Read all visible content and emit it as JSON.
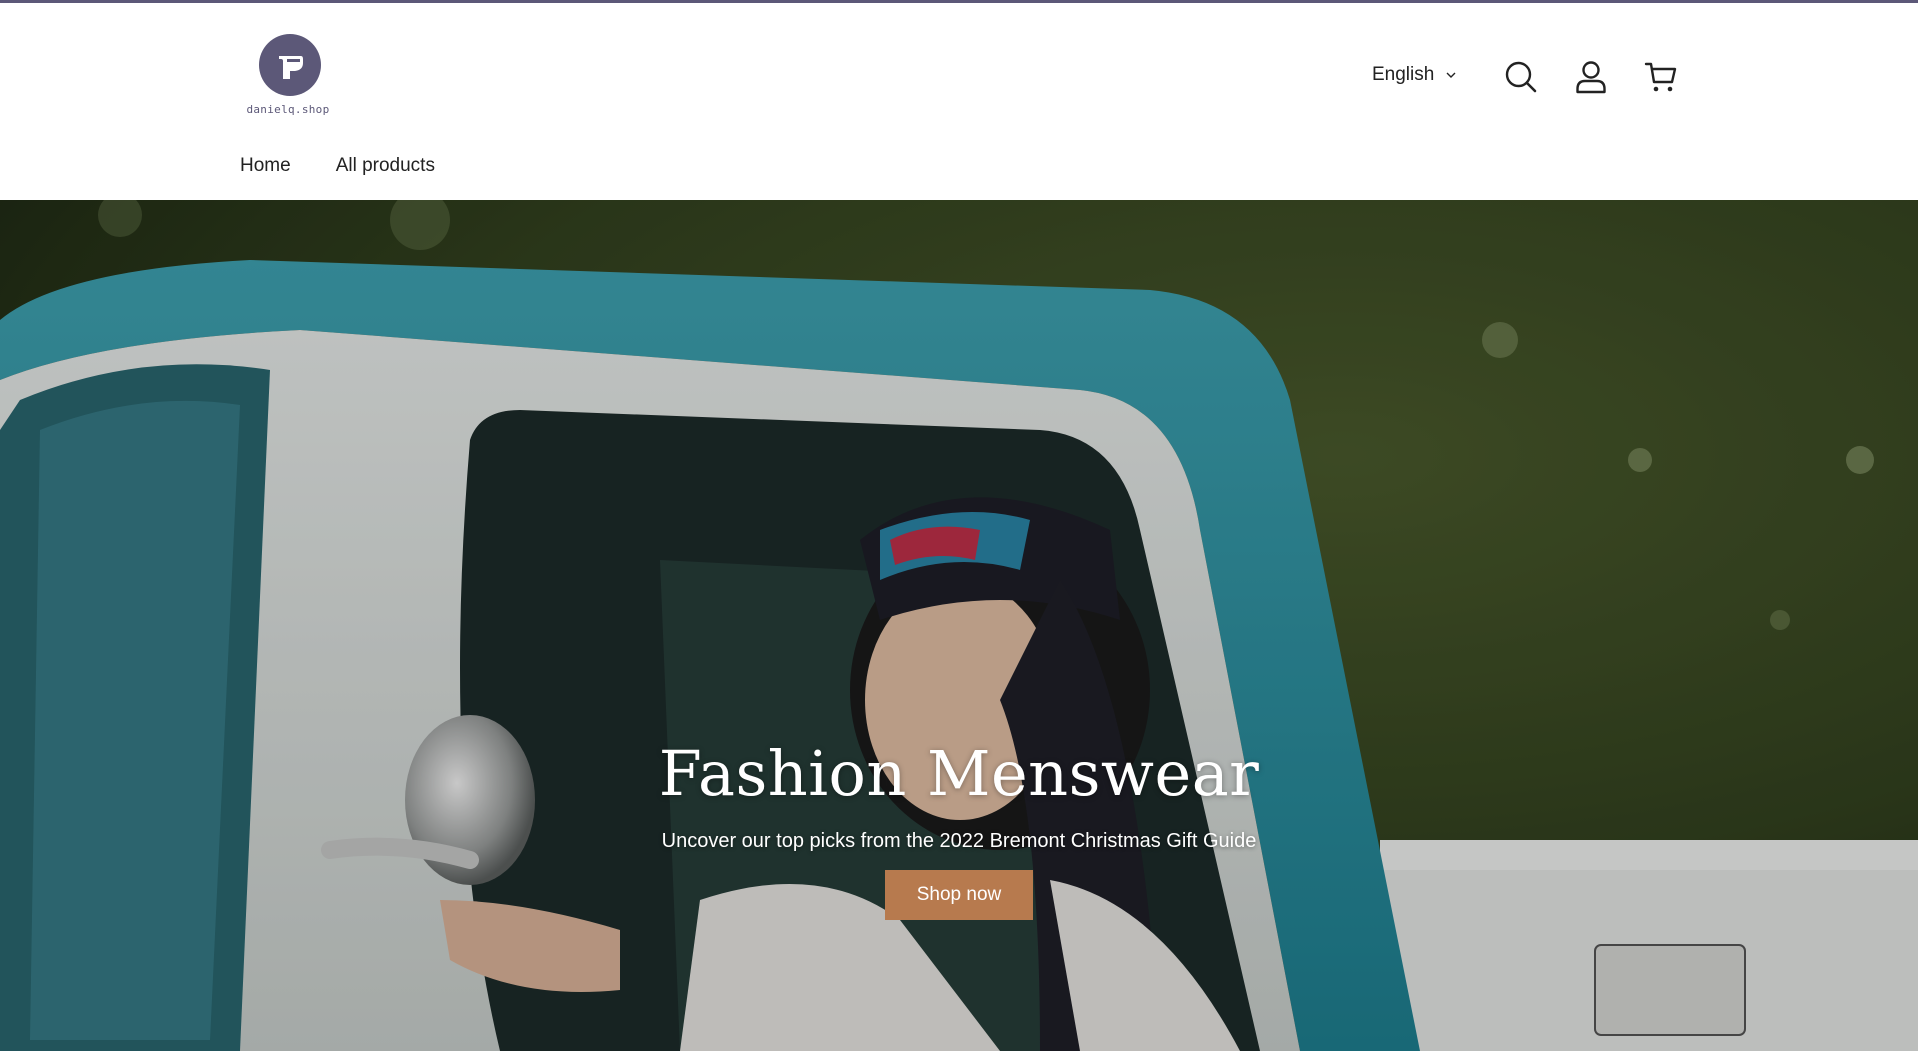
{
  "brand": {
    "logo_text": "danielq.shop",
    "logo_icon": "toilet-logo-icon",
    "colors": {
      "brand": "#5c5878",
      "accent": "#b77a4e",
      "topline": "#5c5878"
    }
  },
  "header": {
    "language": {
      "selected": "English",
      "icon": "chevron-down-icon"
    },
    "icons": {
      "search": "search-icon",
      "account": "user-icon",
      "cart": "cart-icon"
    }
  },
  "nav": {
    "items": [
      {
        "label": "Home"
      },
      {
        "label": "All products"
      }
    ]
  },
  "hero": {
    "title": "Fashion Menswear",
    "subtitle": "Uncover our top picks from the 2022 Bremont Christmas Gift Guide",
    "cta_label": "Shop now",
    "image": "woman-in-turquoise-truck-photo"
  }
}
